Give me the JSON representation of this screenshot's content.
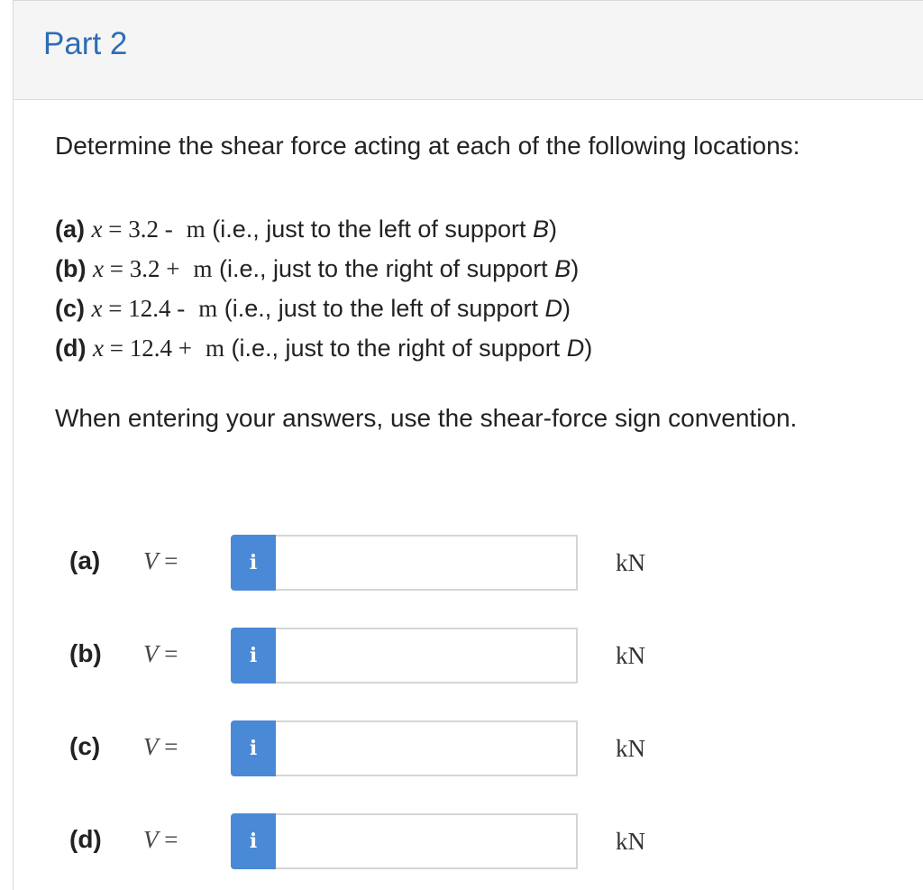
{
  "part": {
    "title": "Part 2"
  },
  "question": {
    "prompt": "Determine the shear force acting at each of the following locations:",
    "locations": [
      {
        "label": "(a)",
        "var": "x",
        "eq": " = ",
        "value": "3.2 -",
        "unit": "m",
        "note_pre": "(i.e., just to the left of support ",
        "support": "B",
        "note_post": ")"
      },
      {
        "label": "(b)",
        "var": "x",
        "eq": " = ",
        "value": "3.2 +",
        "unit": "m",
        "note_pre": "(i.e., just to the right of support ",
        "support": "B",
        "note_post": ")"
      },
      {
        "label": "(c)",
        "var": "x",
        "eq": " = ",
        "value": "12.4 -",
        "unit": "m",
        "note_pre": "(i.e., just to the left of support ",
        "support": "D",
        "note_post": ")"
      },
      {
        "label": "(d)",
        "var": "x",
        "eq": " = ",
        "value": "12.4 +",
        "unit": "m",
        "note_pre": "(i.e., just to the right of support ",
        "support": "D",
        "note_post": ")"
      }
    ],
    "convention": "When entering your answers, use the shear-force sign convention."
  },
  "answers": [
    {
      "label": "(a)",
      "var": "V",
      "eq": " =",
      "info": "i",
      "value": "",
      "unit": "kN"
    },
    {
      "label": "(b)",
      "var": "V",
      "eq": " =",
      "info": "i",
      "value": "",
      "unit": "kN"
    },
    {
      "label": "(c)",
      "var": "V",
      "eq": " =",
      "info": "i",
      "value": "",
      "unit": "kN"
    },
    {
      "label": "(d)",
      "var": "V",
      "eq": " =",
      "info": "i",
      "value": "",
      "unit": "kN"
    }
  ],
  "colors": {
    "title": "#2d6db5",
    "info_button": "#4a89d6",
    "header_bg": "#f5f5f5"
  }
}
